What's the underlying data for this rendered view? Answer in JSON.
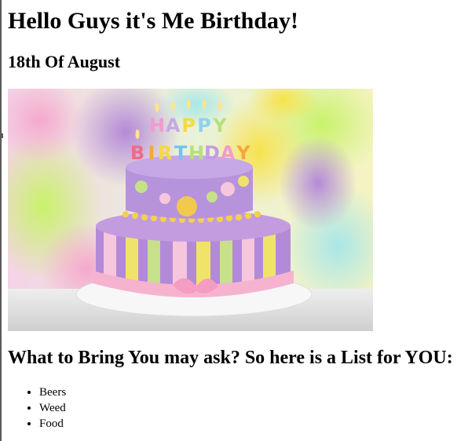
{
  "page": {
    "heading": "Hello Guys it's Me Birthday!",
    "date": "18th Of August",
    "list_heading": "What to Bring You may ask? So here is a List for YOU:",
    "list_items": [
      "Beers",
      "Weed",
      "Food"
    ]
  },
  "photo": {
    "description_icon": "birthday-cake-image",
    "candle_letters": "HAPPY BIRTHDAY"
  },
  "colors": {
    "text": "#000000",
    "background": "#ffffff",
    "border": "#5a5a5a"
  }
}
